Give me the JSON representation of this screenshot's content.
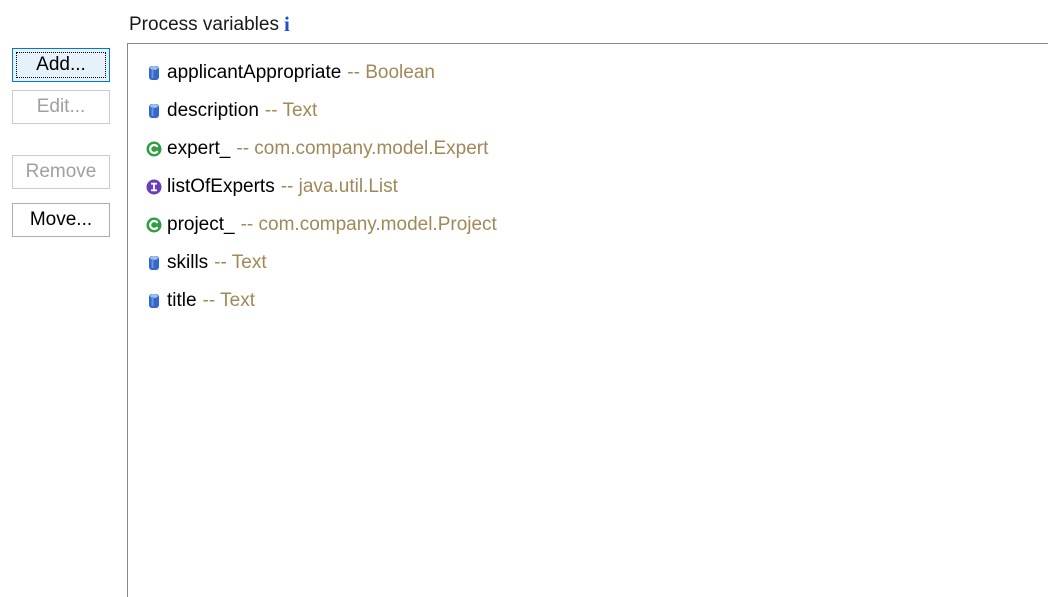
{
  "section": {
    "title": "Process variables",
    "info_icon": "info-icon"
  },
  "buttons": {
    "add": "Add...",
    "edit": "Edit...",
    "remove": "Remove",
    "move": "Move..."
  },
  "variables": [
    {
      "name": "applicantAppropriate",
      "type": "-- Boolean",
      "icon": "cylinder-icon"
    },
    {
      "name": "description",
      "type": "-- Text",
      "icon": "cylinder-icon"
    },
    {
      "name": "expert_",
      "type": "-- com.company.model.Expert",
      "icon": "class-icon"
    },
    {
      "name": "listOfExperts",
      "type": "-- java.util.List",
      "icon": "interface-icon"
    },
    {
      "name": "project_",
      "type": "-- com.company.model.Project",
      "icon": "class-icon"
    },
    {
      "name": "skills",
      "type": "-- Text",
      "icon": "cylinder-icon"
    },
    {
      "name": "title",
      "type": "-- Text",
      "icon": "cylinder-icon"
    }
  ],
  "colors": {
    "type_text": "#a08858",
    "cylinder_icon": "#3566c9",
    "class_icon": "#2f9e44",
    "interface_icon": "#6a3fb5",
    "info_icon": "#1f4fc8"
  }
}
